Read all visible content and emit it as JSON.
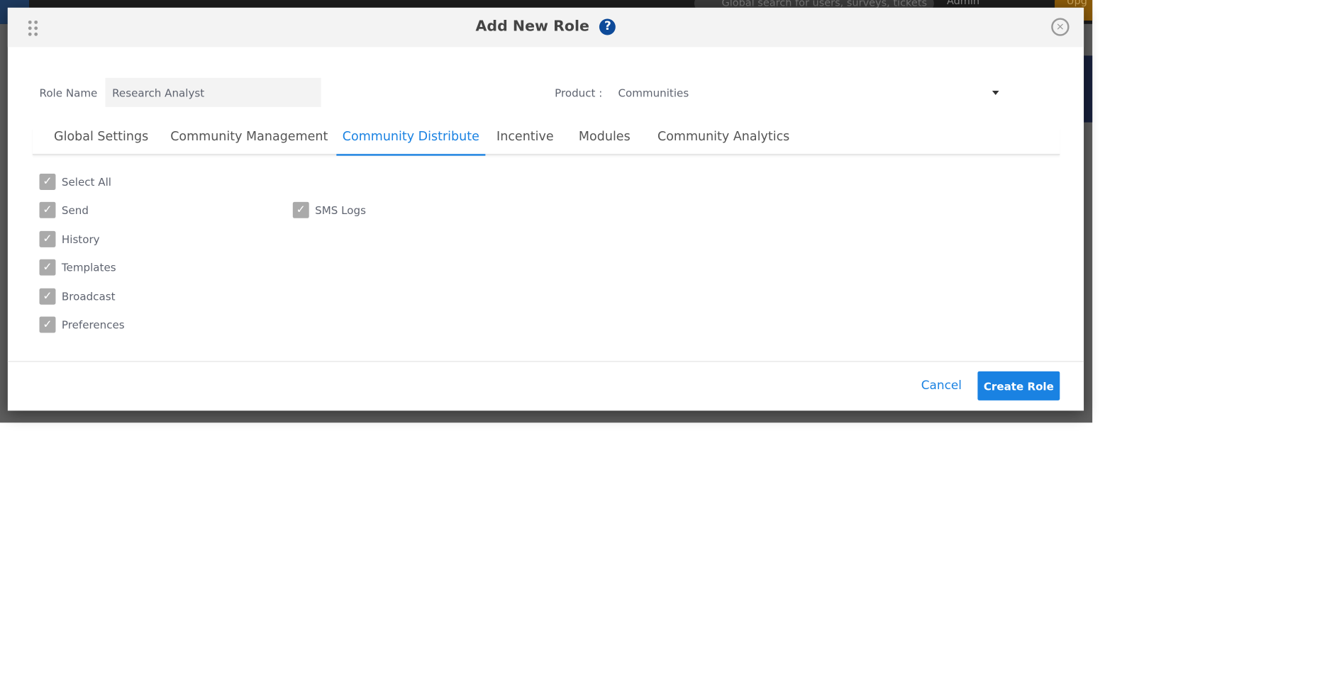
{
  "background": {
    "search_placeholder": "Global search for users, surveys, tickets",
    "user": "Admin",
    "upgrade": "Upg"
  },
  "modal": {
    "title": "Add New Role",
    "role_name_label": "Role Name",
    "role_name_value": "Research Analyst",
    "product_label": "Product :",
    "product_value": "Communities",
    "tabs": [
      "Global Settings",
      "Community Management",
      "Community Distribute",
      "Incentive",
      "Modules",
      "Community Analytics"
    ],
    "active_tab": "Community Distribute",
    "checkboxes": [
      {
        "label": "Select All",
        "checked": true
      },
      {
        "label": "Send",
        "checked": true
      },
      {
        "label": "SMS Logs",
        "checked": true
      },
      {
        "label": "History",
        "checked": true
      },
      {
        "label": "Templates",
        "checked": true
      },
      {
        "label": "Broadcast",
        "checked": true
      },
      {
        "label": "Preferences",
        "checked": true
      }
    ],
    "cancel_label": "Cancel",
    "create_label": "Create Role"
  },
  "colors": {
    "accent": "#1a82e2",
    "help_icon": "#0d4a99",
    "checkbox": "#aaaaaa"
  }
}
